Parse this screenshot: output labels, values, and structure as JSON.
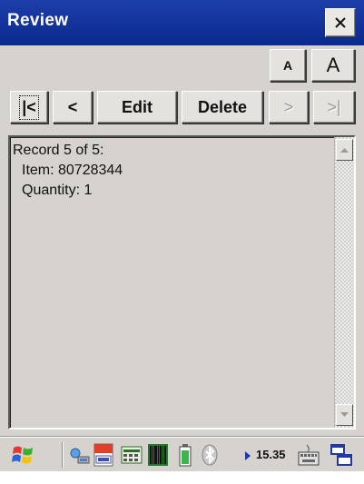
{
  "window": {
    "title": "Review",
    "close_icon": "close-icon"
  },
  "font_buttons": {
    "small_label": "A",
    "large_label": "A"
  },
  "nav": {
    "first_label": "|<",
    "prev_label": "<",
    "edit_label": "Edit",
    "delete_label": "Delete",
    "next_label": ">",
    "last_label": ">|"
  },
  "record": {
    "header": "Record 5 of 5:",
    "item_line": "Item: 80728344",
    "quantity_line": "Quantity: 1"
  },
  "taskbar": {
    "start_icon": "windows-flag-icon",
    "clock": "15.35",
    "tray_text_icon": "Efon VRC"
  },
  "colors": {
    "titlebar": "#0b2a8f",
    "window_bg": "#d6d3ce",
    "accent": "#1f3aa8"
  }
}
